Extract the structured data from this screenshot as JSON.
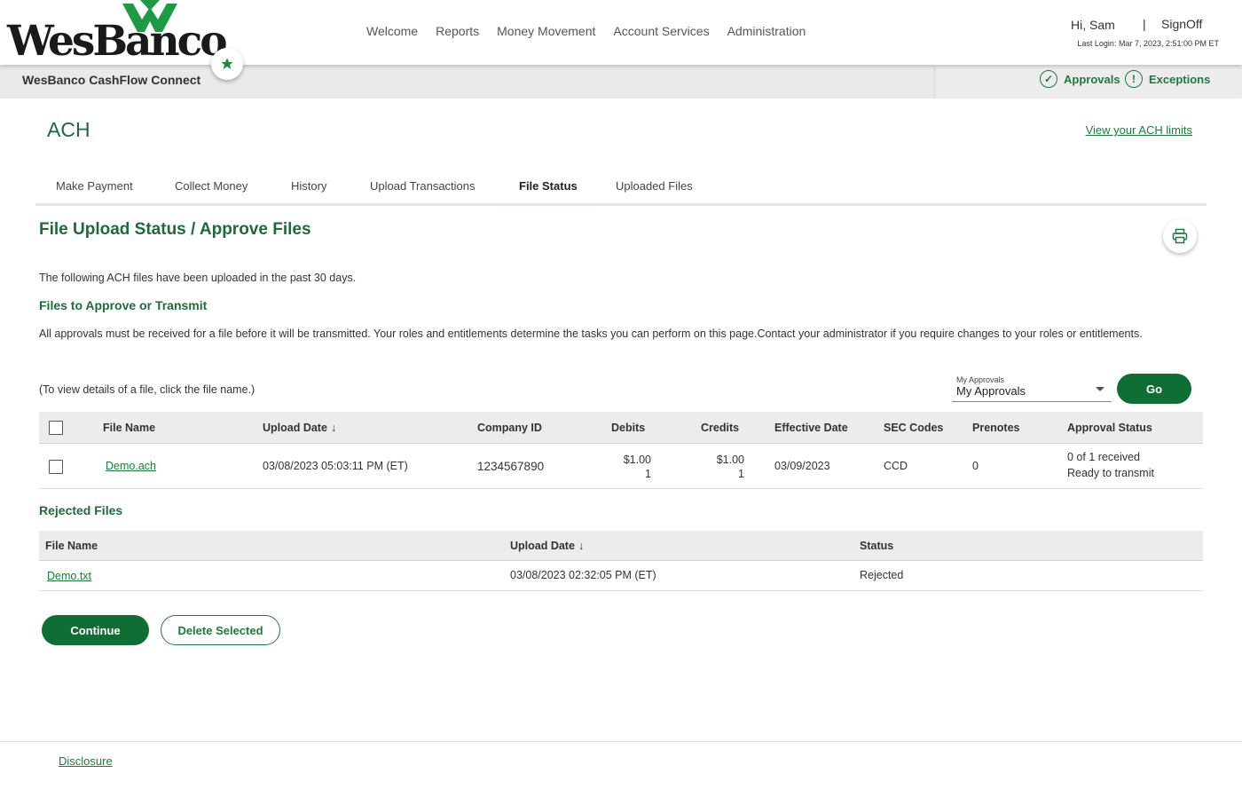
{
  "brand": {
    "logo_text": "WesBanco",
    "app_name": "WesBanco CashFlow Connect"
  },
  "nav": [
    "Welcome",
    "Reports",
    "Money Movement",
    "Account Services",
    "Administration"
  ],
  "user": {
    "greeting": "Hi, Sam",
    "separator": "|",
    "signoff": "SignOff",
    "last_login": "Last Login: Mar 7, 2023, 2:51:00 PM ET"
  },
  "shortcuts": {
    "approvals": "Approvals",
    "exceptions": "Exceptions"
  },
  "page": {
    "title": "ACH",
    "limits_link": "View your ACH limits"
  },
  "tabs": [
    "Make Payment",
    "Collect Money",
    "History",
    "Upload Transactions",
    "File Status",
    "Uploaded Files"
  ],
  "active_tab": "File Status",
  "section": {
    "title": "File Upload Status / Approve Files",
    "intro": "The following ACH files have been uploaded in the past 30 days.",
    "approve_heading": "Files to Approve or Transmit",
    "approve_note": "All approvals must be received for a file before it will be transmitted. Your roles and entitlements determine the tasks you can perform on this page.Contact your administrator if you require changes to your roles or entitlements.",
    "view_hint": "(To view details of a file, click the file name.)"
  },
  "filter": {
    "label": "My Approvals",
    "value": "My Approvals",
    "go": "Go"
  },
  "approve_table": {
    "headers": [
      "File Name",
      "Upload Date",
      "Company ID",
      "Debits",
      "Credits",
      "Effective Date",
      "SEC Codes",
      "Prenotes",
      "Approval Status"
    ],
    "rows": [
      {
        "file_name": "Demo.ach",
        "upload_date": "03/08/2023 05:03:11 PM (ET)",
        "company_id": "1234567890",
        "debits_amount": "$1.00",
        "debits_count": "1",
        "credits_amount": "$1.00",
        "credits_count": "1",
        "effective_date": "03/09/2023",
        "sec_codes": "CCD",
        "prenotes": "0",
        "status_line1": "0 of 1 received",
        "status_line2": "Ready to transmit"
      }
    ]
  },
  "rejected": {
    "heading": "Rejected Files",
    "headers": [
      "File Name",
      "Upload Date",
      "Status"
    ],
    "rows": [
      {
        "file_name": "Demo.txt",
        "upload_date": "03/08/2023 02:32:05 PM (ET)",
        "status": "Rejected"
      }
    ]
  },
  "buttons": {
    "continue": "Continue",
    "delete": "Delete Selected"
  },
  "footer": {
    "disclosure": "Disclosure"
  },
  "colors": {
    "brand_green": "#0f6e33",
    "link_green": "#1e7a3a",
    "title_green": "#1e6b3a"
  }
}
